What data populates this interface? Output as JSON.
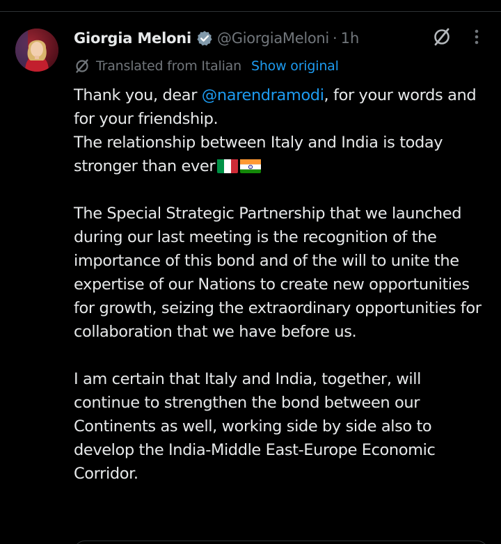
{
  "post": {
    "author": {
      "name": "Giorgia Meloni",
      "handle": "@GiorgiaMeloni",
      "verified": true
    },
    "separator": "·",
    "time": "1h",
    "translation": {
      "label": "Translated from Italian",
      "show_original": "Show original"
    },
    "body": {
      "p1_prefix": "Thank you, dear ",
      "mention": "@narendramodi",
      "p1_suffix": ", for your words and for your friendship.",
      "p2": "The relationship between Italy and India is today stronger than ever",
      "p3": "The Special Strategic Partnership that we launched during our last meeting is the recognition of the importance of this bond and of the will to unite the expertise of our Nations to create new opportunities for growth, seizing the extraordinary opportunities for collaboration that we have before us.",
      "p4": "I am certain that Italy and India, together, will continue to strengthen the bond between our Continents as well, working side by side also to develop the India-Middle East-Europe Economic Corridor."
    },
    "flags": [
      "italy-flag-icon",
      "india-flag-icon"
    ],
    "icons": [
      "verified-badge-icon",
      "grok-icon",
      "more-icon",
      "translate-icon"
    ]
  },
  "colors": {
    "background": "#000000",
    "text": "#e7e9ea",
    "secondary_text": "#71767b",
    "link": "#1d9bf0",
    "divider": "#2f3336"
  }
}
